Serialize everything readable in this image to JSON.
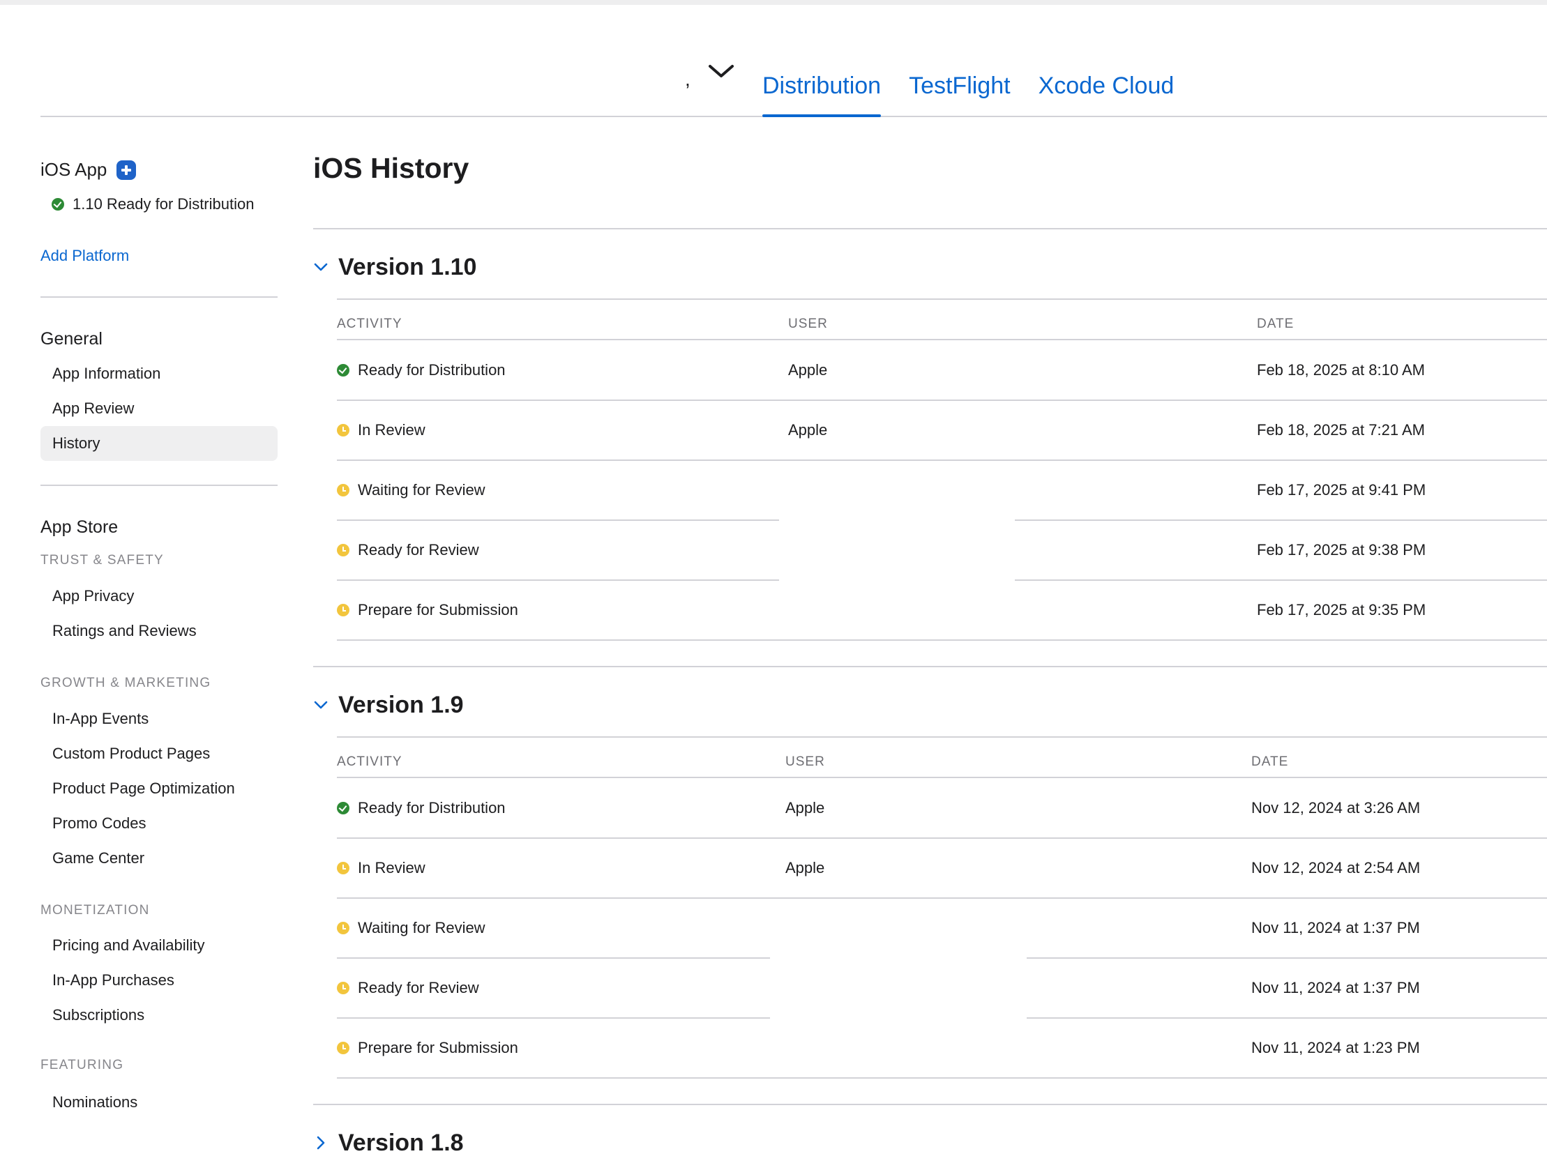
{
  "header": {
    "app_switcher_text": ",",
    "tabs": [
      {
        "label": "Distribution",
        "active": true
      },
      {
        "label": "TestFlight",
        "active": false
      },
      {
        "label": "Xcode Cloud",
        "active": false
      }
    ]
  },
  "sidebar": {
    "platform": {
      "title": "iOS App",
      "status": "1.10 Ready for Distribution",
      "add_platform": "Add Platform"
    },
    "general": {
      "heading": "General",
      "items": [
        "App Information",
        "App Review",
        "History"
      ],
      "selected": "History"
    },
    "app_store": {
      "heading": "App Store",
      "categories": [
        {
          "name": "TRUST & SAFETY",
          "items": [
            "App Privacy",
            "Ratings and Reviews"
          ]
        },
        {
          "name": "GROWTH & MARKETING",
          "items": [
            "In-App Events",
            "Custom Product Pages",
            "Product Page Optimization",
            "Promo Codes",
            "Game Center"
          ]
        },
        {
          "name": "MONETIZATION",
          "items": [
            "Pricing and Availability",
            "In-App Purchases",
            "Subscriptions"
          ]
        },
        {
          "name": "FEATURING",
          "items": [
            "Nominations"
          ]
        }
      ]
    }
  },
  "main": {
    "title": "iOS History",
    "columns": {
      "activity": "ACTIVITY",
      "user": "USER",
      "date": "DATE"
    },
    "versions": [
      {
        "title": "Version 1.10",
        "expanded": true,
        "rows": [
          {
            "status": "success",
            "activity": "Ready for Distribution",
            "user": "Apple",
            "date": "Feb 18, 2025 at 8:10 AM"
          },
          {
            "status": "pending",
            "activity": "In Review",
            "user": "Apple",
            "date": "Feb 18, 2025 at 7:21 AM"
          },
          {
            "status": "pending",
            "activity": "Waiting for Review",
            "user": "",
            "date": "Feb 17, 2025 at 9:41 PM"
          },
          {
            "status": "pending",
            "activity": "Ready for Review",
            "user": "",
            "date": "Feb 17, 2025 at 9:38 PM"
          },
          {
            "status": "pending",
            "activity": "Prepare for Submission",
            "user": "",
            "date": "Feb 17, 2025 at 9:35 PM"
          }
        ]
      },
      {
        "title": "Version 1.9",
        "expanded": true,
        "rows": [
          {
            "status": "success",
            "activity": "Ready for Distribution",
            "user": "Apple",
            "date": "Nov 12, 2024 at 3:26 AM"
          },
          {
            "status": "pending",
            "activity": "In Review",
            "user": "Apple",
            "date": "Nov 12, 2024 at 2:54 AM"
          },
          {
            "status": "pending",
            "activity": "Waiting for Review",
            "user": "",
            "date": "Nov 11, 2024 at 1:37 PM"
          },
          {
            "status": "pending",
            "activity": "Ready for Review",
            "user": "",
            "date": "Nov 11, 2024 at 1:37 PM"
          },
          {
            "status": "pending",
            "activity": "Prepare for Submission",
            "user": "",
            "date": "Nov 11, 2024 at 1:23 PM"
          }
        ]
      },
      {
        "title": "Version 1.8",
        "expanded": false,
        "rows": []
      }
    ]
  },
  "colors": {
    "accent": "#0a67d0",
    "success": "#2d8a35",
    "pending": "#f2c53d",
    "divider": "#d2d2d7"
  }
}
